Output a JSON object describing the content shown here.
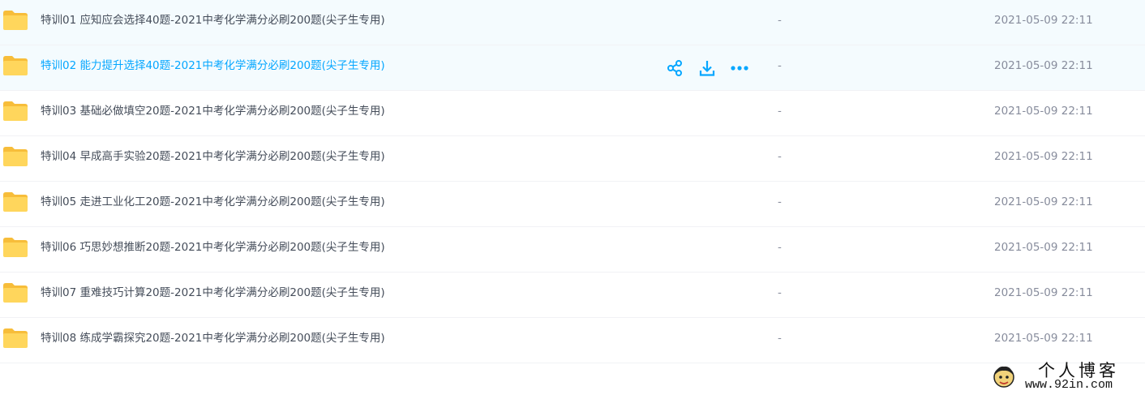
{
  "files": [
    {
      "name": "特训01 应知应会选择40题-2021中考化学满分必刷200题(尖子生专用)",
      "size": "-",
      "modified": "2021-05-09 22:11"
    },
    {
      "name": "特训02 能力提升选择40题-2021中考化学满分必刷200题(尖子生专用)",
      "size": "-",
      "modified": "2021-05-09 22:11"
    },
    {
      "name": "特训03 基础必做填空20题-2021中考化学满分必刷200题(尖子生专用)",
      "size": "-",
      "modified": "2021-05-09 22:11"
    },
    {
      "name": "特训04 早成高手实验20题-2021中考化学满分必刷200题(尖子生专用)",
      "size": "-",
      "modified": "2021-05-09 22:11"
    },
    {
      "name": "特训05 走进工业化工20题-2021中考化学满分必刷200题(尖子生专用)",
      "size": "-",
      "modified": "2021-05-09 22:11"
    },
    {
      "name": "特训06 巧思妙想推断20题-2021中考化学满分必刷200题(尖子生专用)",
      "size": "-",
      "modified": "2021-05-09 22:11"
    },
    {
      "name": "特训07 重难技巧计算20题-2021中考化学满分必刷200题(尖子生专用)",
      "size": "-",
      "modified": "2021-05-09 22:11"
    },
    {
      "name": "特训08 练成学霸探究20题-2021中考化学满分必刷200题(尖子生专用)",
      "size": "-",
      "modified": "2021-05-09 22:11"
    }
  ],
  "row_actions": [
    "share-icon",
    "download-icon",
    "more-icon"
  ],
  "colors": {
    "accent": "#06a7ff",
    "folder": "#ffd65c",
    "folder_tab": "#f7bd3a",
    "hover_bg": "#f4fbfe",
    "text": "#454d5a",
    "muted": "#878c9c"
  },
  "watermark": {
    "title": "个人博客",
    "url": "www.92in.com"
  }
}
